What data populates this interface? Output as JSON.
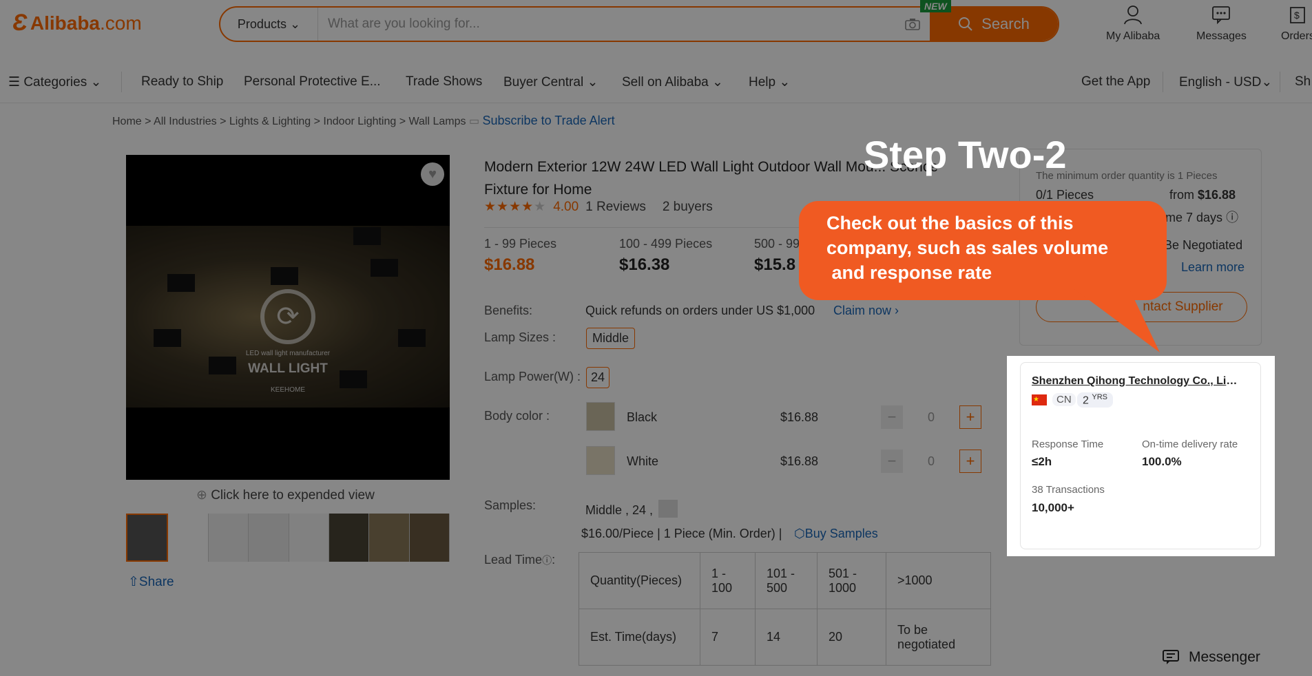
{
  "header": {
    "logo_mark": "Ɛ",
    "logo_name": "Alibaba",
    "logo_suffix": ".com",
    "search_category": "Products",
    "search_placeholder": "What are you looking for...",
    "new_badge": "NEW",
    "search_button": "Search",
    "icons": [
      {
        "name": "user-icon",
        "label": "My Alibaba"
      },
      {
        "name": "message-icon",
        "label": "Messages"
      },
      {
        "name": "orders-icon",
        "label": "Orders"
      }
    ]
  },
  "nav": {
    "categories": "Categories",
    "items": [
      "Ready to Ship",
      "Personal Protective E...",
      "Trade Shows",
      "Buyer Central",
      "Sell on Alibaba",
      "Help"
    ],
    "right": [
      "Get the App",
      "English - USD",
      "Sh"
    ]
  },
  "breadcrumb": {
    "items": [
      "Home",
      "All Industries",
      "Lights & Lighting",
      "Indoor Lighting",
      "Wall Lamps"
    ],
    "subscribe": "Subscribe to Trade Alert"
  },
  "media": {
    "video_caption_small": "LED wall light manufacturer",
    "video_caption": "WALL LIGHT",
    "video_brand": "KEEHOME",
    "expand": "Click here to expended view",
    "share": "Share"
  },
  "product": {
    "title": "Modern Exterior 12W 24W LED Wall Light Outdoor Wall Mou... Sconce Fixture for Home",
    "rating": "4.00",
    "stars": 4,
    "reviews": "1 Reviews",
    "buyers": "2 buyers",
    "tiers": [
      {
        "qty": "1 - 99 Pieces",
        "price": "$16.88"
      },
      {
        "qty": "100 - 499 Pieces",
        "price": "$16.38"
      },
      {
        "qty": "500 - 99",
        "price": "$15.8"
      }
    ],
    "benefits_label": "Benefits:",
    "benefits_text": "Quick refunds on orders under US $1,000",
    "claim": "Claim now",
    "lamp_sizes_label": "Lamp Sizes :",
    "lamp_size": "Middle",
    "lamp_power_label": "Lamp Power(W) :",
    "lamp_power": "24",
    "body_color_label": "Body color :",
    "colors": [
      {
        "name": "Black",
        "price": "$16.88",
        "qty": "0"
      },
      {
        "name": "White",
        "price": "$16.88",
        "qty": "0"
      }
    ],
    "samples_label": "Samples:",
    "samples_sel": "Middle , 24 ,",
    "samples_price": "$16.00/Piece | 1 Piece (Min. Order) |",
    "buy_samples": "Buy Samples",
    "lead_label": "Lead Time",
    "lead_table": {
      "row1": [
        "Quantity(Pieces)",
        "1 - 100",
        "101 - 500",
        "501 - 1000",
        ">1000"
      ],
      "row2": [
        "Est. Time(days)",
        "7",
        "14",
        "20",
        "To be negotiated"
      ]
    }
  },
  "order_card": {
    "moq": "The minimum order quantity is 1 Pieces",
    "pieces": "0/1 Pieces",
    "from_label": "from",
    "from_price": "$16.88",
    "lead": "ime 7 days",
    "negotiated": "Be Negotiated",
    "learn_more": "Learn more",
    "contact": "ntact Supplier"
  },
  "supplier": {
    "name": "Shenzhen Qihong Technology Co., Limi...",
    "country": "CN",
    "years": "2",
    "years_unit": "YRS",
    "response_label": "Response Time",
    "response_value": "≤2h",
    "ontime_label": "On-time delivery rate",
    "ontime_value": "100.0%",
    "transactions_label": "38 Transactions",
    "transactions_value": "10,000+"
  },
  "callout": {
    "title": "Step Two-2",
    "lines": [
      "Check out the basics of this",
      "company, such as sales volume",
      " and response rate"
    ]
  },
  "messenger": "Messenger",
  "colors": {
    "accent": "#ff6a00",
    "callout": "#f05a22",
    "link": "#1a66b8"
  }
}
